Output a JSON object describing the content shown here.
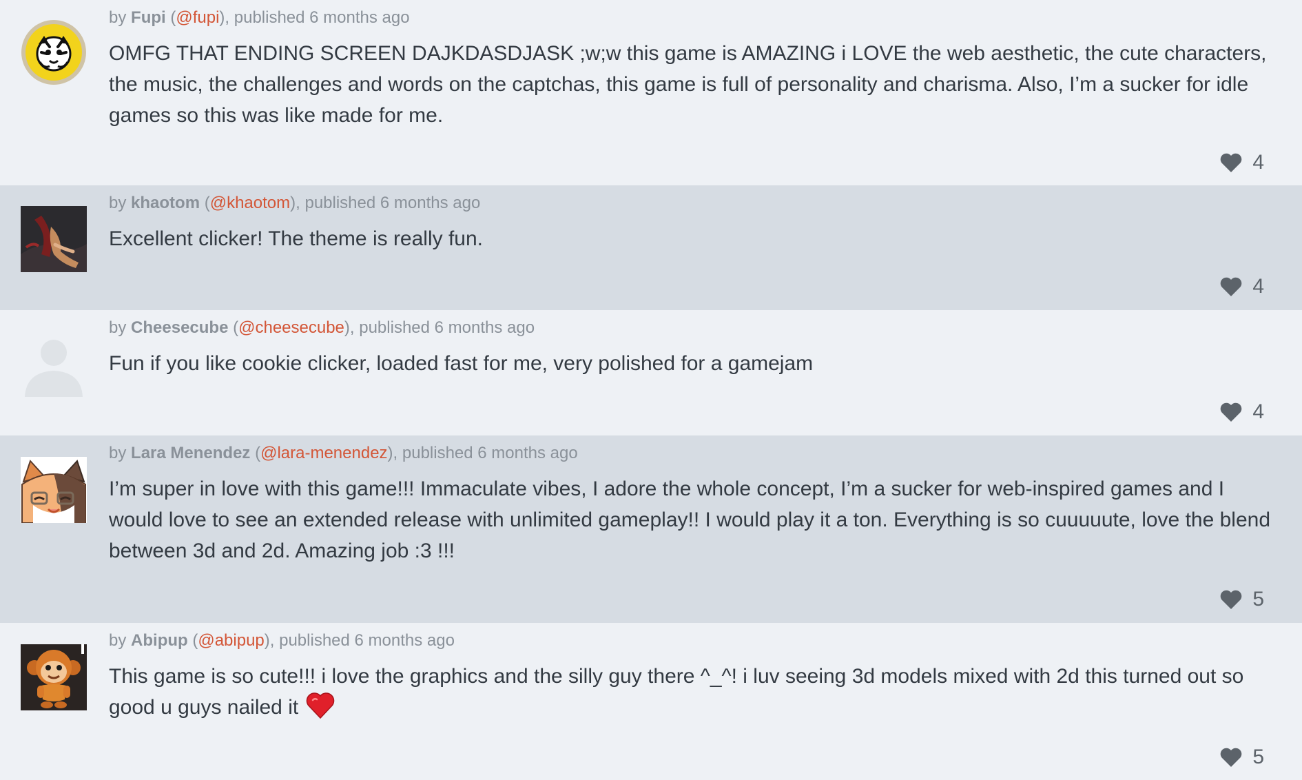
{
  "comments": [
    {
      "by_prefix": "by",
      "author": "Fupi",
      "handle": "@fupi",
      "published": "published 6 months ago",
      "text": "OMFG THAT ENDING SCREEN DAJKDASDJASK ;w;w this game is AMAZING i LOVE the web aesthetic, the cute characters, the music, the challenges and words on the captchas, this game is full of personality and charisma. Also, I’m a sucker for idle games so this was like made for me.",
      "likes": "4",
      "avatar_icon": "tiger-avatar-icon"
    },
    {
      "by_prefix": "by",
      "author": "khaotom",
      "handle": "@khaotom",
      "published": "published 6 months ago",
      "text": "Excellent clicker! The theme is really fun.",
      "likes": "4",
      "avatar_icon": "dark-figure-avatar-icon"
    },
    {
      "by_prefix": "by",
      "author": "Cheesecube",
      "handle": "@cheesecube",
      "published": "published 6 months ago",
      "text": "Fun if you like cookie clicker, loaded fast for me, very polished for a gamejam",
      "likes": "4",
      "avatar_icon": "default-user-avatar-icon"
    },
    {
      "by_prefix": "by",
      "author": "Lara Menendez",
      "handle": "@lara-menendez",
      "published": "published 6 months ago",
      "text": "I’m super in love with this game!!! Immaculate vibes, I adore the whole concept, I’m a sucker for web-inspired games and I would love to see an extended release with unlimited gameplay!! I would play it a ton. Everything is so cuuuuute, love the blend between 3d and 2d. Amazing job :3 !!!",
      "likes": "5",
      "avatar_icon": "cat-girl-avatar-icon"
    },
    {
      "by_prefix": "by",
      "author": "Abipup",
      "handle": "@abipup",
      "published": "published 6 months ago",
      "text": "This game is so cute!!! i love the graphics and the silly guy there ^_^! i luv seeing 3d models mixed with 2d this turned out so good u guys nailed it",
      "likes": "5",
      "avatar_icon": "monkey-avatar-icon"
    }
  ],
  "colors": {
    "background_light": "#eef1f5",
    "background_dark": "#d6dce3",
    "handle": "#d35637",
    "meta_text": "#8a9199",
    "body_text": "#333a42",
    "like_icon": "#5c636a",
    "emoji_heart": "#e0202a"
  }
}
